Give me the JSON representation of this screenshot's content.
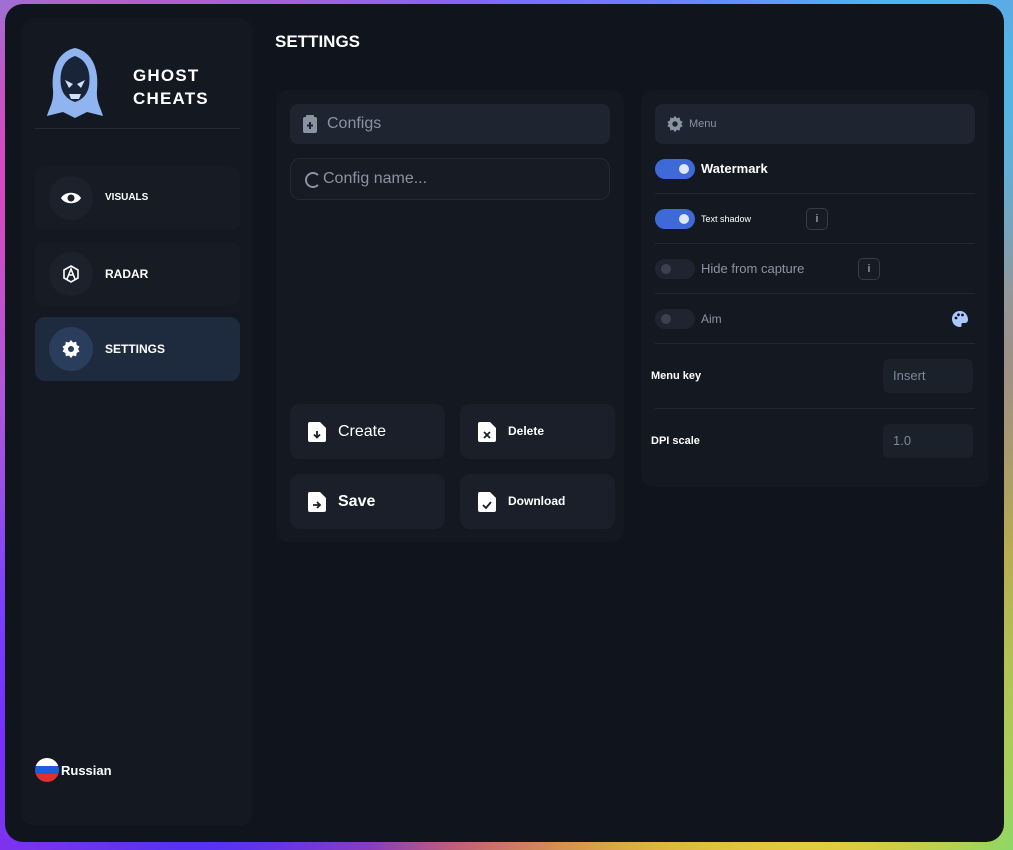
{
  "brand": {
    "line1": "GHOST",
    "line2": "CHEATS"
  },
  "sidebar": {
    "items": [
      {
        "label": "VISUALS",
        "icon": "eye-icon"
      },
      {
        "label": "RADAR",
        "icon": "radar-icon"
      },
      {
        "label": "SETTINGS",
        "icon": "gear-icon",
        "active": true
      }
    ],
    "language": "Russian"
  },
  "page": {
    "title": "SETTINGS"
  },
  "configs": {
    "title": "Configs",
    "input_placeholder": "Config name...",
    "buttons": {
      "create": "Create",
      "delete": "Delete",
      "save": "Save",
      "download": "Download"
    }
  },
  "menu": {
    "title": "Menu",
    "watermark": {
      "label": "Watermark",
      "on": true
    },
    "text_shadow": {
      "label": "Text shadow",
      "on": true,
      "info": "i"
    },
    "hide_capture": {
      "label": "Hide from capture",
      "on": false,
      "info": "i"
    },
    "aim": {
      "label": "Aim",
      "on": false
    },
    "menu_key": {
      "label": "Menu key",
      "value": "Insert"
    },
    "dpi_scale": {
      "label": "DPI scale",
      "value": "1.0"
    }
  },
  "colors": {
    "accent": "#3d6ad6",
    "window": "#10141c",
    "panel": "#141921"
  }
}
